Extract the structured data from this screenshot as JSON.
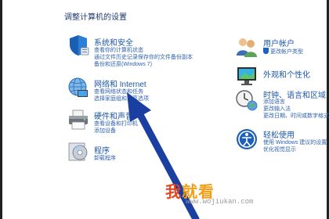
{
  "page_title": "调整计算机的设置",
  "categories": {
    "system": {
      "title": "系统和安全",
      "links": [
        "查看你的计算机状态",
        "通过文件历史记录保存你的文件备份副本",
        "备份和还原(Windows 7)"
      ]
    },
    "network": {
      "title": "网络和 Internet",
      "links": [
        "查看网络状态和任务",
        "选择家庭组和共享选项"
      ]
    },
    "hardware": {
      "title": "硬件和声音",
      "links": [
        "查看设备和打印机",
        "添加设备"
      ]
    },
    "programs": {
      "title": "程序",
      "links": [
        "卸载程序"
      ]
    },
    "accounts": {
      "title": "用户帐户",
      "links": [
        "更改帐户类型"
      ]
    },
    "appearance": {
      "title": "外观和个性化",
      "links": []
    },
    "clock": {
      "title": "时钟、语言和区域",
      "links": [
        "添加语言",
        "更改输入法",
        "更改日期、时间或数字格式"
      ]
    },
    "ease": {
      "title": "轻松使用",
      "links": [
        "使用 Windows 建议的设置",
        "优化视觉显示"
      ]
    }
  },
  "watermark": {
    "brand_a": "我",
    "brand_b": "就看",
    "url": "www.wojiukan.com"
  },
  "colors": {
    "link": "#2f62b0",
    "heading": "#1d56a8",
    "arrow": "#1a3fa0"
  }
}
